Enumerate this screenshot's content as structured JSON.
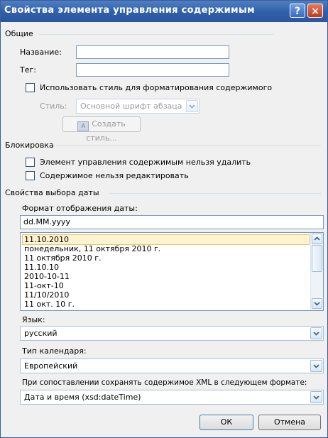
{
  "window": {
    "title": "Свойства элемента управления содержимым",
    "help_glyph": "?",
    "close_glyph": "×"
  },
  "general": {
    "group_label": "Общие",
    "name_label": "Название:",
    "name_value": "",
    "tag_label": "Тег:",
    "tag_value": "",
    "use_style_label": "Использовать стиль для форматирования содержимого",
    "use_style_checked": false,
    "style_label": "Стиль:",
    "style_value": "Основной шрифт абзаца",
    "create_style_button": "Создать стиль..."
  },
  "locking": {
    "group_label": "Блокировка",
    "cannot_delete_label": "Элемент управления содержимым нельзя удалить",
    "cannot_edit_label": "Содержимое нельзя редактировать"
  },
  "date_props": {
    "group_label": "Свойства выбора даты",
    "format_label": "Формат отображения даты:",
    "format_value": "dd.MM.yyyy",
    "formats": [
      "11.10.2010",
      "понедельник, 11 октября 2010 г.",
      "11 октября 2010 г.",
      "11.10.10",
      "2010-10-11",
      "11-окт-10",
      "11/10/2010",
      "11 окт. 10 г."
    ],
    "selected_index": 0,
    "language_label": "Язык:",
    "language_value": "русский",
    "calendar_label": "Тип календаря:",
    "calendar_value": "Европейский",
    "xml_label": "При сопоставлении сохранять содержимое XML в следующем формате:",
    "xml_value": "Дата и время (xsd:dateTime)"
  },
  "buttons": {
    "ok": "ОК",
    "cancel": "Отмена"
  },
  "colors": {
    "title_bar": "#2f5fa8",
    "selection": "#fff2cf"
  }
}
